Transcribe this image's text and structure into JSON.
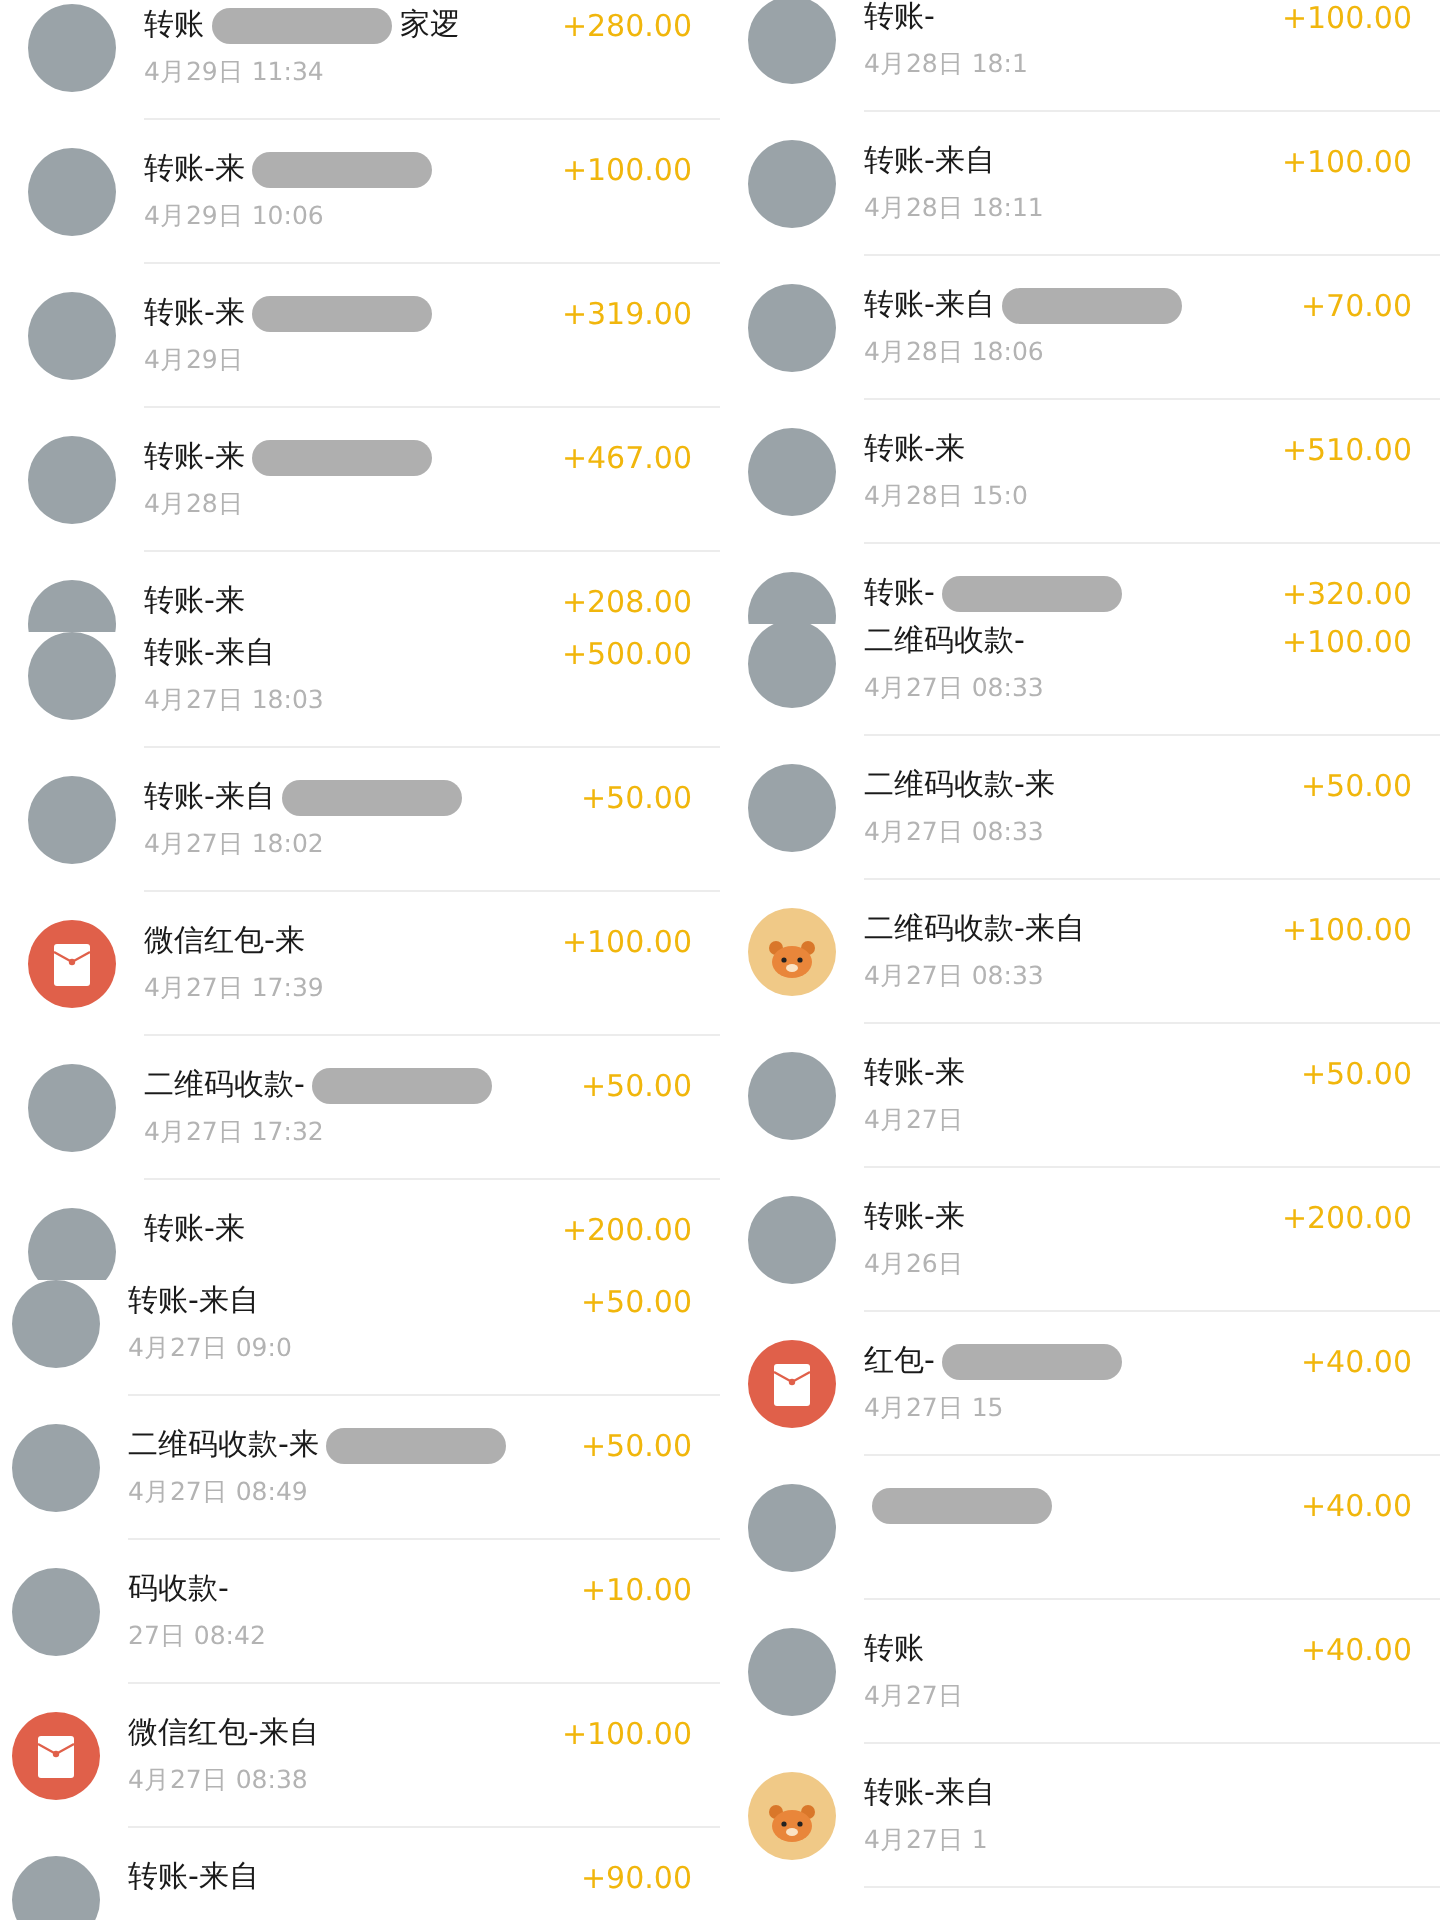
{
  "left_column": {
    "segments": [
      {
        "rows": [
          {
            "kind": "photo",
            "title": "转账",
            "title_tail": "家逻",
            "redacted": true,
            "time": "4月29日 11:34",
            "amount": "+280.00"
          },
          {
            "kind": "photo",
            "title": "转账-来",
            "redacted": true,
            "time": "4月29日 10:06",
            "amount": "+100.00"
          },
          {
            "kind": "photo",
            "title": "转账-来",
            "redacted": true,
            "time": "4月29日",
            "amount": "+319.00"
          },
          {
            "kind": "photo",
            "title": "转账-来",
            "redacted": true,
            "time": "4月28日",
            "amount": "+467.00"
          },
          {
            "kind": "photo",
            "title": "转账-来",
            "redacted": false,
            "amount": "+208.00"
          }
        ]
      },
      {
        "rows": [
          {
            "kind": "photo",
            "title": "转账-来自",
            "redacted": false,
            "time": "4月27日 18:03",
            "amount": "+500.00"
          },
          {
            "kind": "photo",
            "title": "转账-来自",
            "redacted": true,
            "time": "4月27日 18:02",
            "amount": "+50.00"
          },
          {
            "kind": "red_packet",
            "title": "微信红包-来",
            "redacted": false,
            "time": "4月27日 17:39",
            "amount": "+100.00"
          },
          {
            "kind": "photo",
            "title": "二维码收款-",
            "redacted": true,
            "time": "4月27日 17:32",
            "amount": "+50.00"
          },
          {
            "kind": "photo",
            "title": "转账-来",
            "redacted": false,
            "amount": "+200.00"
          }
        ]
      },
      {
        "rows": [
          {
            "kind": "photo",
            "title": "转账-来自",
            "redacted": false,
            "time": "4月27日 09:0",
            "amount": "+50.00"
          },
          {
            "kind": "photo",
            "title": "二维码收款-来",
            "redacted": true,
            "time": "4月27日 08:49",
            "amount": "+50.00"
          },
          {
            "kind": "photo",
            "title": "码收款-",
            "redacted": false,
            "time": "27日 08:42",
            "amount": "+10.00"
          },
          {
            "kind": "red_packet",
            "title": "微信红包-来自",
            "redacted": false,
            "time": "4月27日 08:38",
            "amount": "+100.00"
          },
          {
            "kind": "photo",
            "title": "转账-来自",
            "redacted": false,
            "amount": "+90.00"
          }
        ]
      }
    ]
  },
  "right_column": {
    "segments": [
      {
        "rows": [
          {
            "kind": "photo",
            "title": "转账-",
            "redacted": false,
            "time": "4月28日 18:1",
            "amount": "+100.00"
          },
          {
            "kind": "photo",
            "title": "转账-来自",
            "redacted": false,
            "time": "4月28日 18:11",
            "amount": "+100.00"
          },
          {
            "kind": "photo",
            "title": "转账-来自",
            "redacted": true,
            "time": "4月28日 18:06",
            "amount": "+70.00"
          },
          {
            "kind": "photo",
            "title": "转账-来",
            "redacted": false,
            "time": "4月28日 15:0",
            "amount": "+510.00"
          },
          {
            "kind": "photo",
            "title": "转账-",
            "redacted": true,
            "amount": "+320.00"
          }
        ]
      },
      {
        "rows": [
          {
            "kind": "photo",
            "title": "二维码收款-",
            "redacted": false,
            "time": "4月27日 08:33",
            "amount": "+100.00"
          },
          {
            "kind": "photo",
            "title": "二维码收款-来",
            "redacted": false,
            "time": "4月27日 08:33",
            "amount": "+50.00"
          },
          {
            "kind": "tiger",
            "title": "二维码收款-来自",
            "redacted": false,
            "time": "4月27日 08:33",
            "amount": "+100.00"
          },
          {
            "kind": "photo",
            "title": "转账-来",
            "redacted": false,
            "time": "4月27日",
            "amount": "+50.00"
          },
          {
            "kind": "photo",
            "title": "转账-来",
            "redacted": false,
            "time": "4月26日",
            "amount": "+200.00"
          },
          {
            "kind": "red_packet",
            "title": "红包-",
            "redacted": true,
            "time": "4月27日 15",
            "amount": "+40.00"
          },
          {
            "kind": "photo",
            "redacted": true,
            "amount": "+40.00"
          },
          {
            "kind": "photo",
            "title": "转账",
            "redacted": false,
            "time": "4月27日",
            "amount": "+40.00"
          },
          {
            "kind": "tiger",
            "title": "转账-来自",
            "redacted": false,
            "time": "4月27日 1"
          }
        ]
      }
    ]
  }
}
